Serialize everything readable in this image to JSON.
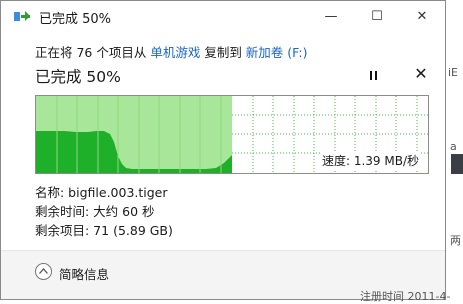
{
  "window": {
    "title": "已完成 50%",
    "controls": {
      "minimize": "—",
      "maximize": "☐",
      "close": "✕"
    }
  },
  "status": {
    "prefix": "正在将 76 个项目从 ",
    "source": "单机游戏",
    "middle": " 复制到 ",
    "destination": "新加卷 (F:)",
    "headline": "已完成 50%"
  },
  "actions": {
    "pause_icon": "pause-icon",
    "cancel_icon": "close-icon",
    "cancel_glyph": "✕"
  },
  "graph": {
    "progress": 0.5,
    "speed_label": "速度: 1.39 MB/秒",
    "colors": {
      "completed_bg": "#a8e69a",
      "throughput_fill": "#1fb02a",
      "grid": "#44bb44",
      "remaining_bg": "#ffffff"
    }
  },
  "details": {
    "name": "名称: bigfile.003.tiger",
    "time_left": "剩余时间: 大约 60 秒",
    "items_left": "剩余项目: 71 (5.89 GB)"
  },
  "footer": {
    "collapse_label": "简略信息",
    "collapse_icon": "chevron-up-icon"
  },
  "background": {
    "right_fragments": [
      "iE",
      "a",
      "两",
      "2011-4"
    ],
    "bottom_text": "注册时间   2011-4-"
  }
}
